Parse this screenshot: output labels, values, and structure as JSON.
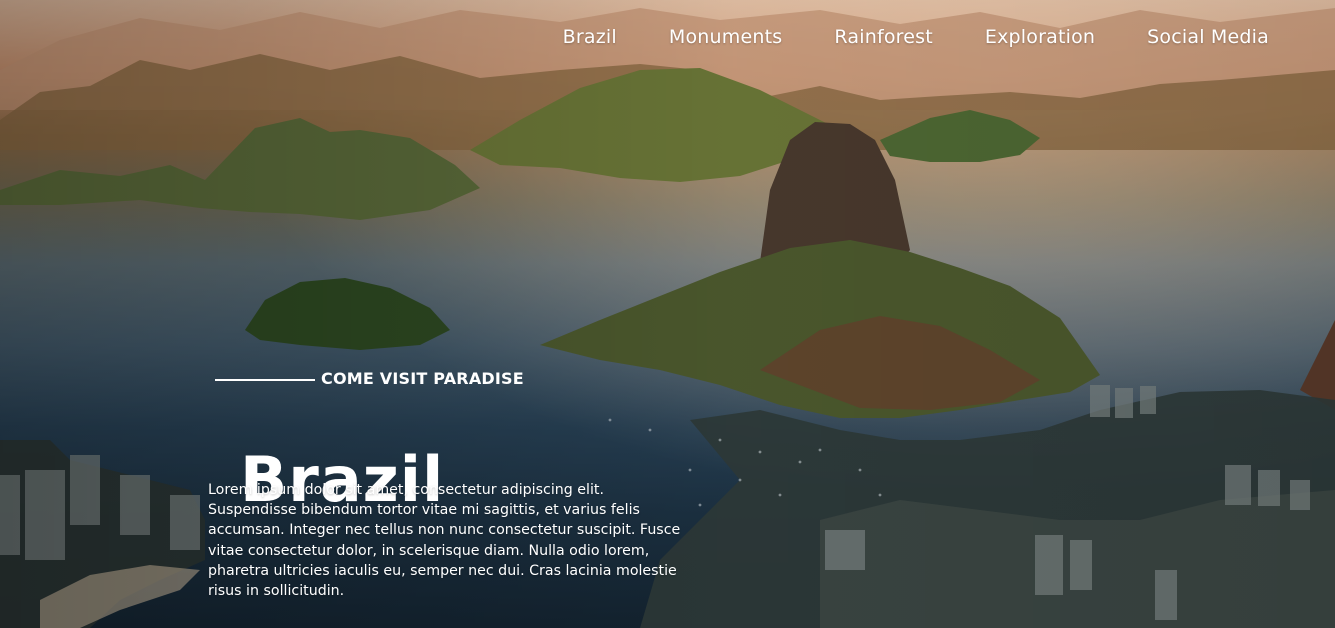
{
  "nav": {
    "items": [
      {
        "label": "Brazil"
      },
      {
        "label": "Monuments"
      },
      {
        "label": "Rainforest"
      },
      {
        "label": "Exploration"
      },
      {
        "label": "Social Media"
      }
    ]
  },
  "hero": {
    "eyebrow": "COME VISIT PARADISE",
    "title": "Brazil",
    "description": "Lorem ipsum dolor sit amet, consectetur adipiscing elit. Suspendisse bibendum tortor vitae mi sagittis, et varius felis accumsan. Integer nec tellus non nunc consectetur suscipit. Fusce vitae consectetur dolor, in scelerisque diam. Nulla odio lorem, pharetra ultricies iaculis eu, semper nec dui. Cras lacinia molestie risus in sollicitudin."
  },
  "background": {
    "subject": "Rio de Janeiro bay with Sugarloaf Mountain",
    "colors": {
      "sky": "#d9b59a",
      "mountains": "#8b6a46",
      "water": "#274054",
      "text": "#ffffff"
    }
  }
}
